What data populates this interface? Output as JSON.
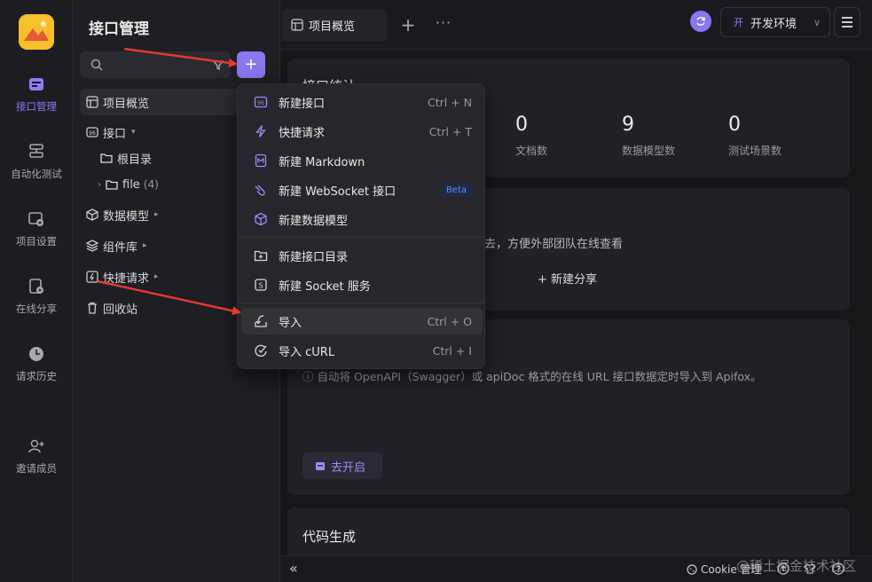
{
  "colors": {
    "accent": "#8a76ee",
    "arrow": "#e53a2f",
    "logo": "#f7c02b"
  },
  "nav": {
    "items": [
      {
        "label": "接口管理",
        "icon": "api-icon",
        "active": true
      },
      {
        "label": "自动化测试",
        "icon": "automation-icon"
      },
      {
        "label": "项目设置",
        "icon": "settings-icon"
      },
      {
        "label": "在线分享",
        "icon": "share-icon"
      },
      {
        "label": "请求历史",
        "icon": "history-icon"
      },
      {
        "label": "邀请成员",
        "icon": "invite-icon"
      }
    ]
  },
  "sidebar": {
    "title": "接口管理",
    "search_placeholder": "",
    "tree": [
      {
        "label": "项目概览",
        "icon": "overview-icon"
      },
      {
        "label": "接口",
        "icon": "api-tag-icon"
      },
      {
        "label": "根目录",
        "icon": "folder-icon"
      },
      {
        "label": "file",
        "icon": "folder-icon",
        "count": "(4)"
      },
      {
        "label": "数据模型",
        "icon": "model-icon"
      },
      {
        "label": "组件库",
        "icon": "component-icon"
      },
      {
        "label": "快捷请求",
        "icon": "quick-request-icon"
      },
      {
        "label": "回收站",
        "icon": "trash-icon"
      }
    ]
  },
  "topbar": {
    "tab_label": "项目概览",
    "env_badge": "开",
    "env_label": "开发环境"
  },
  "main": {
    "stats_title": "接口统计",
    "stats": [
      {
        "num": "0",
        "label": "文档数"
      },
      {
        "num": "9",
        "label": "数据模型数"
      },
      {
        "num": "0",
        "label": "测试场景数"
      }
    ],
    "share_text": "去，方便外部团队在线查看",
    "share_button": "+ 新建分享",
    "import_tip": "ⓘ 自动将 OpenAPI（Swagger）或 apiDoc 格式的在线 URL 接口数据定时导入到 Apifox。",
    "go_button": "去开启",
    "codegen_title": "代码生成"
  },
  "dropdown": {
    "items": [
      {
        "label": "新建接口",
        "shortcut": "Ctrl + N",
        "icon": "new-api-icon"
      },
      {
        "label": "快捷请求",
        "shortcut": "Ctrl + T",
        "icon": "lightning-icon"
      },
      {
        "label": "新建 Markdown",
        "shortcut": "",
        "icon": "markdown-icon"
      },
      {
        "label": "新建 WebSocket 接口",
        "badge": "Beta",
        "icon": "websocket-icon"
      },
      {
        "label": "新建数据模型",
        "shortcut": "",
        "icon": "cube-icon"
      },
      {
        "label": "新建接口目录",
        "shortcut": "",
        "icon": "folder-add-icon"
      },
      {
        "label": "新建 Socket 服务",
        "shortcut": "",
        "icon": "socket-icon"
      },
      {
        "label": "导入",
        "shortcut": "Ctrl + O",
        "icon": "import-icon"
      },
      {
        "label": "导入 cURL",
        "shortcut": "Ctrl + I",
        "icon": "curl-icon"
      }
    ]
  },
  "bottombar": {
    "cookie_label": "Cookie 管理",
    "watermark": "@稀土掘金技术社区"
  }
}
